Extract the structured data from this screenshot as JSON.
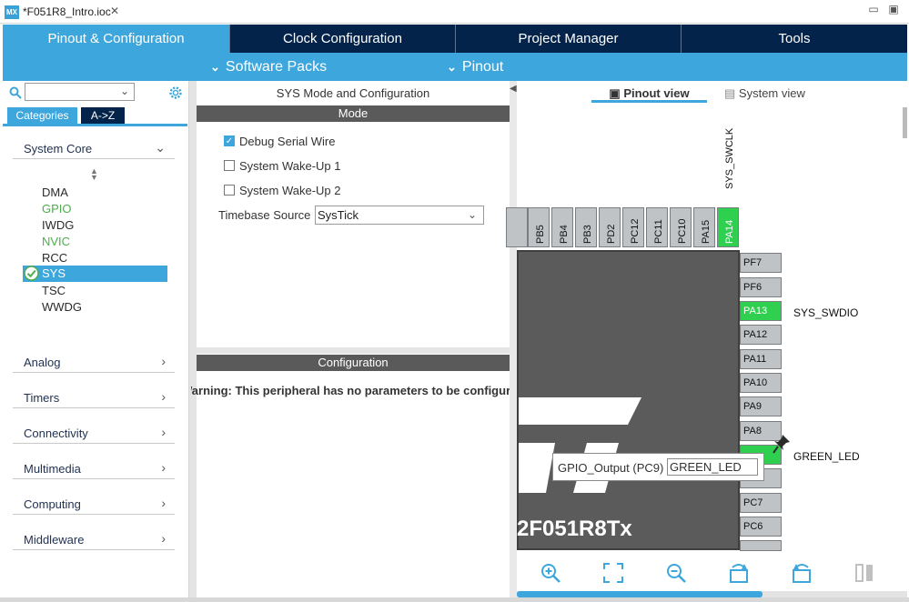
{
  "editor_tab": {
    "logo": "MX",
    "title": "*F051R8_Intro.ioc"
  },
  "main_tabs": [
    {
      "label": "Pinout & Configuration",
      "active": true
    },
    {
      "label": "Clock Configuration",
      "active": false
    },
    {
      "label": "Project Manager",
      "active": false
    },
    {
      "label": "Tools",
      "active": false
    }
  ],
  "subbar": {
    "software_packs": "Software Packs",
    "pinout": "Pinout"
  },
  "left": {
    "search_placeholder": "",
    "tabs": {
      "categories": "Categories",
      "az": "A->Z"
    },
    "categories": [
      {
        "label": "System Core",
        "expanded": true
      },
      {
        "label": "Analog"
      },
      {
        "label": "Timers"
      },
      {
        "label": "Connectivity"
      },
      {
        "label": "Multimedia"
      },
      {
        "label": "Computing"
      },
      {
        "label": "Middleware"
      }
    ],
    "system_core_items": [
      {
        "label": "DMA",
        "status": "normal"
      },
      {
        "label": "GPIO",
        "status": "configured"
      },
      {
        "label": "IWDG",
        "status": "normal"
      },
      {
        "label": "NVIC",
        "status": "configured"
      },
      {
        "label": "RCC",
        "status": "normal"
      },
      {
        "label": "SYS",
        "status": "selected"
      },
      {
        "label": "TSC",
        "status": "normal"
      },
      {
        "label": "WWDG",
        "status": "normal"
      }
    ]
  },
  "middle": {
    "title": "SYS Mode and Configuration",
    "mode_header": "Mode",
    "options": [
      {
        "label": "Debug Serial Wire",
        "checked": true
      },
      {
        "label": "System Wake-Up 1",
        "checked": false
      },
      {
        "label": "System Wake-Up 2",
        "checked": false
      }
    ],
    "timebase_label": "Timebase Source",
    "timebase_value": "SysTick",
    "config_header": "Configuration",
    "warning": "Warning: This peripheral has no parameters to be configured."
  },
  "right": {
    "pinout_view": "Pinout view",
    "system_view": "System view",
    "top_pins": [
      "PB5",
      "PB4",
      "PB3",
      "PD2",
      "PC12",
      "PC11",
      "PC10",
      "PA15",
      "PA14"
    ],
    "top_signal": "SYS_SWCLK",
    "right_pins": [
      "PF7",
      "PF6",
      "PA13",
      "PA12",
      "PA11",
      "PA10",
      "PA9",
      "PA8",
      "",
      "",
      "PC7",
      "PC6"
    ],
    "signals": {
      "pa13": "SYS_SWDIO",
      "pc9": "GREEN_LED"
    },
    "chip_name": "2F051R8Tx",
    "tooltip": {
      "label": "GPIO_Output (PC9)",
      "value": "GREEN_LED"
    },
    "colors": {
      "active_pin": "#2fcf4f",
      "accent": "#3ca6dd",
      "dark_navy": "#03234b"
    }
  }
}
